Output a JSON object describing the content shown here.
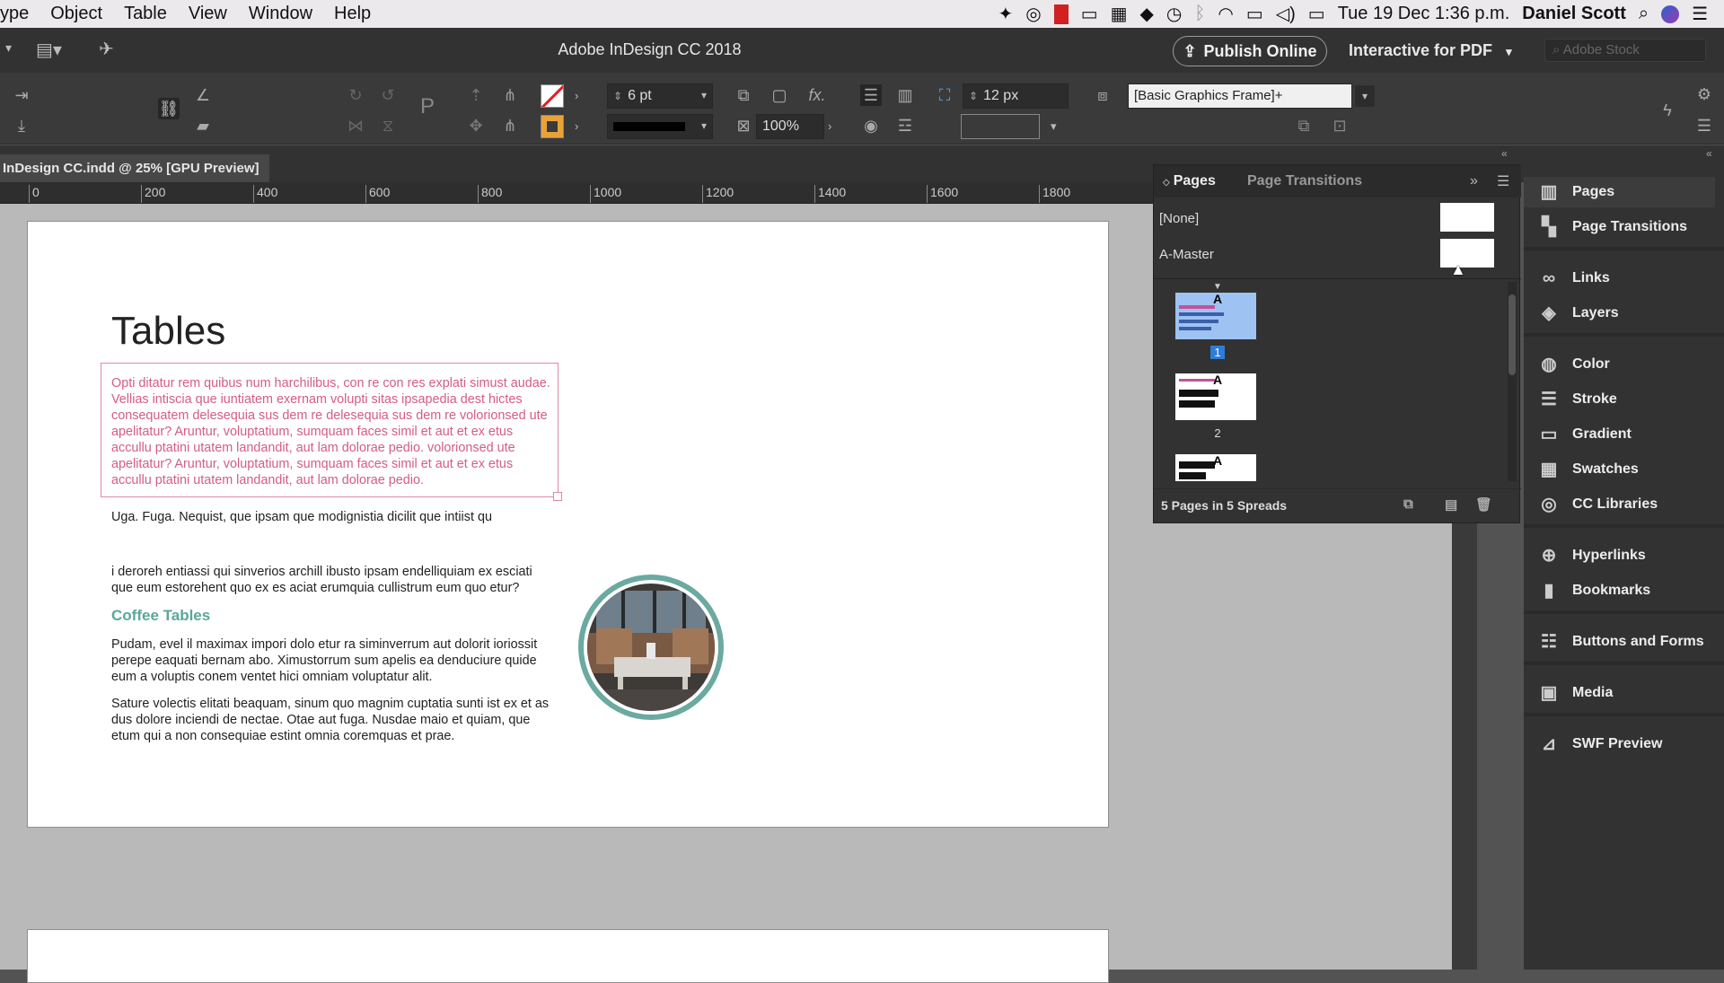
{
  "menubar": {
    "items": [
      "ype",
      "Object",
      "Table",
      "View",
      "Window",
      "Help"
    ],
    "clock": "Tue 19 Dec  1:36 p.m.",
    "user": "Daniel Scott"
  },
  "appbar": {
    "title": "Adobe InDesign CC 2018",
    "publish": "Publish Online",
    "workspace": "Interactive for PDF",
    "stock_placeholder": "Adobe Stock"
  },
  "control": {
    "stroke_weight": "6 pt",
    "opacity": "100%",
    "spacing": "12 px",
    "object_style": "[Basic Graphics Frame]+"
  },
  "doc": {
    "tab": "InDesign CC.indd @ 25% [GPU Preview]",
    "ruler": [
      "0",
      "200",
      "400",
      "600",
      "800",
      "1000",
      "1200",
      "1400",
      "1600",
      "1800"
    ]
  },
  "page": {
    "title": "Tables",
    "pink_text": "Opti ditatur rem quibus num harchilibus, con re con res explati simust audae. Vellias intiscia que iuntiatem exernam volupti sitas ipsapedia dest hictes consequatem delesequia sus dem re delesequia sus dem re volorionsed ute apelitatur? Aruntur, voluptatium, sumquam faces simil et aut et ex etus accullu ptatini utatem landandit, aut lam dolorae pedio. volorionsed ute apelitatur? Aruntur, voluptatium, sumquam faces simil et aut et ex etus accullu ptatini utatem landandit, aut lam dolorae pedio.",
    "para1": "Uga. Fuga. Nequist, que ipsam que modignistia dicilit que intiist qu",
    "para2": "i deroreh entiassi qui sinverios archill ibusto ipsam endelliquiam ex esciati que eum estorehent quo ex es aciat erumquia cullistrum eum quo etur?",
    "heading": "Coffee Tables",
    "para3": "Pudam, evel il maximax impori dolo etur ra siminverrum aut dolorit ioriossit perepe eaquati bernam abo. Ximustorrum sum apelis ea denduciure quide eum a voluptis conem ventet hici omniam voluptatur alit.",
    "para4": "Sature volectis elitati beaquam, sinum quo magnim cuptatia sunti ist ex et as dus dolore inciendi de nectae. Otae aut fuga. Nusdae maio et quiam, que etum qui a non consequiae estint omnia coremquas et prae."
  },
  "pages_panel": {
    "tab_pages": "Pages",
    "tab_transitions": "Page Transitions",
    "masters": [
      "[None]",
      "A-Master"
    ],
    "thumb_master_letter": "A",
    "page_numbers": [
      "1",
      "2"
    ],
    "status": "5 Pages in 5 Spreads"
  },
  "dock": {
    "items": [
      "Pages",
      "Page Transitions",
      "Links",
      "Layers",
      "Color",
      "Stroke",
      "Gradient",
      "Swatches",
      "CC Libraries",
      "Hyperlinks",
      "Bookmarks",
      "Buttons and Forms",
      "Media",
      "SWF Preview"
    ]
  },
  "colors": {
    "pink_text": "#d45c85",
    "teal_heading": "#5aa79a",
    "selected_page": "#2f7bd8"
  }
}
